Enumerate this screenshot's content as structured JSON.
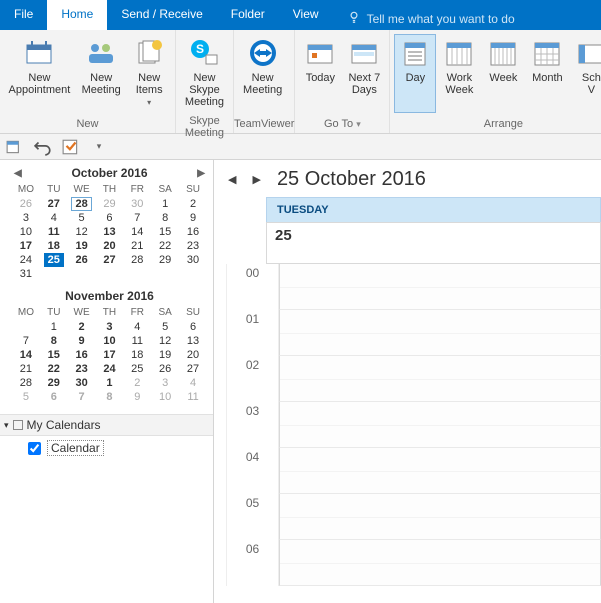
{
  "tabs": {
    "file": "File",
    "home": "Home",
    "sendreceive": "Send / Receive",
    "folder": "Folder",
    "view": "View",
    "tellme": "Tell me what you want to do"
  },
  "ribbon": {
    "groups": {
      "new": "New",
      "skype": "Skype Meeting",
      "teamviewer": "TeamViewer",
      "goto": "Go To",
      "arrange": "Arrange"
    },
    "buttons": {
      "newAppointment": {
        "l1": "New",
        "l2": "Appointment"
      },
      "newMeeting": {
        "l1": "New",
        "l2": "Meeting"
      },
      "newItems": {
        "l1": "New",
        "l2": "Items"
      },
      "skype": {
        "l1": "New Skype",
        "l2": "Meeting"
      },
      "tvMeeting": {
        "l1": "New",
        "l2": "Meeting"
      },
      "today": {
        "l1": "Today",
        "l2": ""
      },
      "next7": {
        "l1": "Next 7",
        "l2": "Days"
      },
      "day": {
        "l1": "Day",
        "l2": ""
      },
      "workweek": {
        "l1": "Work",
        "l2": "Week"
      },
      "week": {
        "l1": "Week",
        "l2": ""
      },
      "month": {
        "l1": "Month",
        "l2": ""
      },
      "schedule": {
        "l1": "Sch",
        "l2": "V"
      }
    }
  },
  "months": [
    {
      "title": "October 2016",
      "weekdays": [
        "MO",
        "TU",
        "WE",
        "TH",
        "FR",
        "SA",
        "SU"
      ],
      "rows": [
        [
          {
            "v": "26",
            "cls": "dim"
          },
          {
            "v": "27",
            "cls": "bold"
          },
          {
            "v": "28",
            "cls": "bold hov"
          },
          {
            "v": "29",
            "cls": "dim"
          },
          {
            "v": "30",
            "cls": "dim"
          },
          {
            "v": "1",
            "cls": ""
          },
          {
            "v": "2",
            "cls": ""
          }
        ],
        [
          {
            "v": "3",
            "cls": ""
          },
          {
            "v": "4",
            "cls": ""
          },
          {
            "v": "5",
            "cls": ""
          },
          {
            "v": "6",
            "cls": ""
          },
          {
            "v": "7",
            "cls": ""
          },
          {
            "v": "8",
            "cls": ""
          },
          {
            "v": "9",
            "cls": ""
          }
        ],
        [
          {
            "v": "10",
            "cls": ""
          },
          {
            "v": "11",
            "cls": "bold"
          },
          {
            "v": "12",
            "cls": ""
          },
          {
            "v": "13",
            "cls": "bold"
          },
          {
            "v": "14",
            "cls": ""
          },
          {
            "v": "15",
            "cls": ""
          },
          {
            "v": "16",
            "cls": ""
          }
        ],
        [
          {
            "v": "17",
            "cls": "bold"
          },
          {
            "v": "18",
            "cls": "bold"
          },
          {
            "v": "19",
            "cls": "bold"
          },
          {
            "v": "20",
            "cls": "bold"
          },
          {
            "v": "21",
            "cls": ""
          },
          {
            "v": "22",
            "cls": ""
          },
          {
            "v": "23",
            "cls": ""
          }
        ],
        [
          {
            "v": "24",
            "cls": ""
          },
          {
            "v": "25",
            "cls": "bold sel"
          },
          {
            "v": "26",
            "cls": "bold"
          },
          {
            "v": "27",
            "cls": "bold"
          },
          {
            "v": "28",
            "cls": ""
          },
          {
            "v": "29",
            "cls": ""
          },
          {
            "v": "30",
            "cls": ""
          }
        ],
        [
          {
            "v": "31",
            "cls": ""
          },
          {
            "v": "",
            "cls": ""
          },
          {
            "v": "",
            "cls": ""
          },
          {
            "v": "",
            "cls": ""
          },
          {
            "v": "",
            "cls": ""
          },
          {
            "v": "",
            "cls": ""
          },
          {
            "v": "",
            "cls": ""
          }
        ]
      ]
    },
    {
      "title": "November 2016",
      "weekdays": [
        "MO",
        "TU",
        "WE",
        "TH",
        "FR",
        "SA",
        "SU"
      ],
      "rows": [
        [
          {
            "v": "",
            "cls": ""
          },
          {
            "v": "1",
            "cls": ""
          },
          {
            "v": "2",
            "cls": "bold"
          },
          {
            "v": "3",
            "cls": "bold"
          },
          {
            "v": "4",
            "cls": ""
          },
          {
            "v": "5",
            "cls": ""
          },
          {
            "v": "6",
            "cls": ""
          }
        ],
        [
          {
            "v": "7",
            "cls": ""
          },
          {
            "v": "8",
            "cls": "bold"
          },
          {
            "v": "9",
            "cls": "bold"
          },
          {
            "v": "10",
            "cls": "bold"
          },
          {
            "v": "11",
            "cls": ""
          },
          {
            "v": "12",
            "cls": ""
          },
          {
            "v": "13",
            "cls": ""
          }
        ],
        [
          {
            "v": "14",
            "cls": "bold"
          },
          {
            "v": "15",
            "cls": "bold"
          },
          {
            "v": "16",
            "cls": "bold"
          },
          {
            "v": "17",
            "cls": "bold"
          },
          {
            "v": "18",
            "cls": ""
          },
          {
            "v": "19",
            "cls": ""
          },
          {
            "v": "20",
            "cls": ""
          }
        ],
        [
          {
            "v": "21",
            "cls": ""
          },
          {
            "v": "22",
            "cls": "bold"
          },
          {
            "v": "23",
            "cls": "bold"
          },
          {
            "v": "24",
            "cls": "bold"
          },
          {
            "v": "25",
            "cls": ""
          },
          {
            "v": "26",
            "cls": ""
          },
          {
            "v": "27",
            "cls": ""
          }
        ],
        [
          {
            "v": "28",
            "cls": ""
          },
          {
            "v": "29",
            "cls": "bold"
          },
          {
            "v": "30",
            "cls": "bold"
          },
          {
            "v": "1",
            "cls": "bold"
          },
          {
            "v": "2",
            "cls": "dim"
          },
          {
            "v": "3",
            "cls": "dim"
          },
          {
            "v": "4",
            "cls": "dim"
          }
        ],
        [
          {
            "v": "5",
            "cls": "dim"
          },
          {
            "v": "6",
            "cls": "bold dim"
          },
          {
            "v": "7",
            "cls": "bold dim"
          },
          {
            "v": "8",
            "cls": "bold dim"
          },
          {
            "v": "9",
            "cls": "dim"
          },
          {
            "v": "10",
            "cls": "dim"
          },
          {
            "v": "11",
            "cls": "dim"
          }
        ]
      ]
    }
  ],
  "sidebar": {
    "groupTitle": "My Calendars",
    "calendarName": "Calendar"
  },
  "pane": {
    "title": "25 October 2016",
    "dayHeader": "TUESDAY",
    "dayNumber": "25",
    "hours": [
      "00",
      "01",
      "02",
      "03",
      "04",
      "05",
      "06"
    ]
  }
}
